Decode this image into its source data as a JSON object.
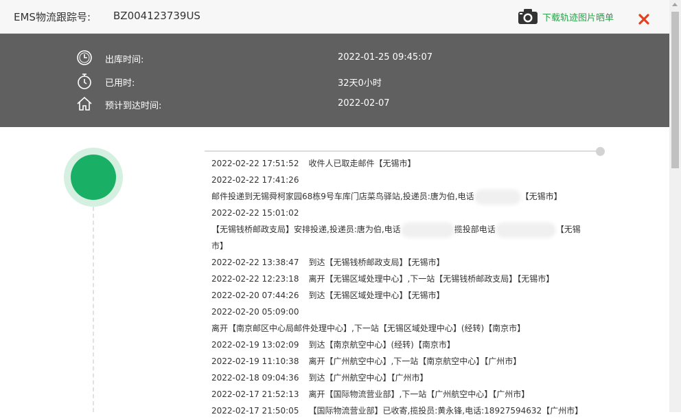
{
  "header": {
    "title_label": "EMS物流跟踪号:",
    "tracking_number": "BZ004123739US",
    "download_label": "下载轨迹图片晒单",
    "close_icon": "close-icon"
  },
  "info": {
    "rows": [
      {
        "icon": "clock-icon",
        "label": "出库时间:",
        "value": "2022-01-25 09:45:07"
      },
      {
        "icon": "stopwatch-icon",
        "label": "已用时:",
        "value": "32天0小时"
      },
      {
        "icon": "home-icon",
        "label": "预计到达时间:",
        "value": "2022-02-07"
      }
    ]
  },
  "timeline": {
    "entries": [
      {
        "time": "2022-02-22 17:51:52",
        "text": "收件人已取走邮件【无锡市】"
      },
      {
        "time": "2022-02-22 17:41:26",
        "text_a": "邮件投递到无锡舜柯家园68栋9号车库门店菜鸟驿站,投递员:唐为伯,电话",
        "text_b": "【无锡市】"
      },
      {
        "time": "2022-02-22 15:01:02",
        "text_a": "【无锡钱桥邮政支局】安排投递,投递员:唐为伯,电话",
        "text_b": "揽投部电话",
        "text_c": "【无锡市】"
      },
      {
        "time": "2022-02-22 13:38:47",
        "text": "到达【无锡钱桥邮政支局】【无锡市】"
      },
      {
        "time": "2022-02-22 12:23:18",
        "text": "离开【无锡区域处理中心】,下一站【无锡钱桥邮政支局】【无锡市】"
      },
      {
        "time": "2022-02-20 07:44:26",
        "text": "到达【无锡区域处理中心】【无锡市】"
      },
      {
        "time": "2022-02-20 05:09:00",
        "text": "离开【南京邮区中心局邮件处理中心】,下一站【无锡区域处理中心】(经转)【南京市】"
      },
      {
        "time": "2022-02-19 13:02:09",
        "text": "到达【南京航空中心】(经转)【南京市】"
      },
      {
        "time": "2022-02-19 11:10:38",
        "text": "离开【广州航空中心】,下一站【南京航空中心】【广州市】"
      },
      {
        "time": "2022-02-18 09:04:36",
        "text": "到达【广州航空中心】【广州市】"
      },
      {
        "time": "2022-02-17 21:52:13",
        "text": "离开【国际物流营业部】,下一站【广州航空中心】【广州市】"
      },
      {
        "time": "2022-02-17 21:50:05",
        "text": "【国际物流营业部】已收寄,揽投员:黄永锋,电话:18927594632【广州市】"
      }
    ]
  },
  "colors": {
    "accent_green": "#19b066",
    "link_green": "#2aa34a",
    "close_red": "#e0421e",
    "info_bg": "#606060"
  }
}
